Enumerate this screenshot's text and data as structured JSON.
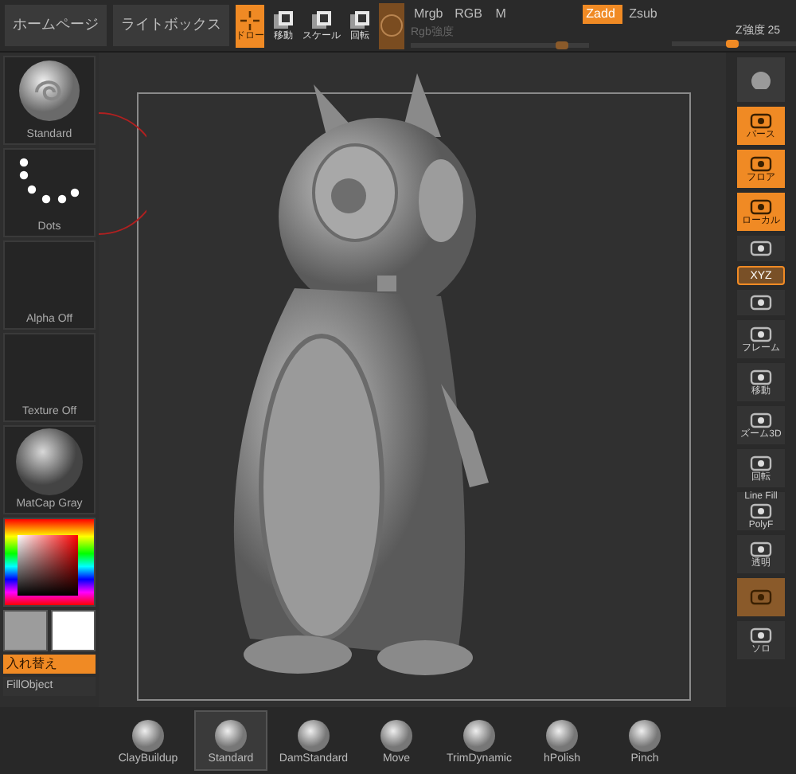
{
  "top_bar": {
    "buttons": [
      {
        "label": "ホームページ"
      },
      {
        "label": "ライトボックス"
      }
    ],
    "tools": [
      {
        "label": "ドロー",
        "selected": true
      },
      {
        "label": "移動",
        "selected": false
      },
      {
        "label": "スケール",
        "selected": false
      },
      {
        "label": "回転",
        "selected": false
      }
    ],
    "material_button": {
      "on": true
    },
    "modes": [
      {
        "label": "Mrgb",
        "selected": false
      },
      {
        "label": "RGB",
        "selected": false
      },
      {
        "label": "M",
        "selected": false
      }
    ],
    "z_modes": [
      {
        "label": "Zadd",
        "selected": true
      },
      {
        "label": "Zsub",
        "selected": false
      }
    ],
    "rgb_intensity": {
      "label": "Rgb強度",
      "disabled": true,
      "level": 0.85
    },
    "z_intensity": {
      "label": "Z強度 25",
      "level": 0.45
    }
  },
  "left_panel": {
    "items": [
      {
        "kind": "brush",
        "label": "Standard"
      },
      {
        "kind": "stroke",
        "label": "Dots"
      },
      {
        "kind": "empty",
        "label": "Alpha Off"
      },
      {
        "kind": "empty",
        "label": "Texture Off"
      },
      {
        "kind": "material",
        "label": "MatCap Gray"
      }
    ],
    "swatches": [
      {
        "color": "#9c9c9c"
      },
      {
        "color": "#ffffff"
      }
    ],
    "swap_button": "入れ替え",
    "fill_button": "FillObject"
  },
  "right_toolbar": [
    {
      "on": false
    },
    {
      "label": "パース",
      "on": true
    },
    {
      "label": "フロア",
      "on": true
    },
    {
      "label": "ローカル",
      "on": true
    },
    {
      "on": false
    },
    {
      "label": "XYZ",
      "on": true,
      "kind": "toggle"
    },
    {
      "on": false
    },
    {
      "label": "フレーム",
      "on": false
    },
    {
      "label": "移動",
      "on": false
    },
    {
      "label": "ズーム3D",
      "on": false
    },
    {
      "label": "回転",
      "on": false
    },
    {
      "title": "Line Fill",
      "label": "PolyF",
      "on": false
    },
    {
      "label": "透明",
      "on": false
    },
    {
      "on": true
    },
    {
      "label": "ソロ",
      "on": false
    }
  ],
  "shelf": [
    {
      "label": "ClayBuildup",
      "selected": false
    },
    {
      "label": "Standard",
      "selected": true
    },
    {
      "label": "DamStandard",
      "selected": false
    },
    {
      "label": "Move",
      "selected": false
    },
    {
      "label": "TrimDynamic",
      "selected": false
    },
    {
      "label": "hPolish",
      "selected": false
    },
    {
      "label": "Pinch",
      "selected": false
    }
  ]
}
